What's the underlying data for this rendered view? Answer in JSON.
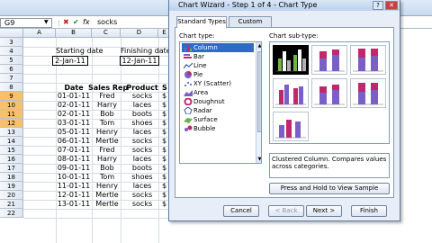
{
  "formula_bar": {
    "name_box": "G9",
    "fx_buttons": [
      "✖",
      "✔",
      "fx"
    ],
    "value": "socks"
  },
  "columns": [
    "A",
    "B",
    "C",
    "D",
    "E"
  ],
  "rows": [
    "3",
    "4",
    "5",
    "6",
    "7",
    "8",
    "9",
    "10",
    "11",
    "12",
    "13",
    "14",
    "15",
    "16",
    "17",
    "18",
    "19",
    "20",
    "21",
    "22"
  ],
  "labels": {
    "starting_date_label": "Starting date",
    "finishing_date_label": "Finishing date",
    "starting_date": "2-Jan-11",
    "finishing_date": "12-Jan-11"
  },
  "table": {
    "headers": [
      "Date",
      "Sales Rep",
      "Product",
      "S"
    ],
    "rows": [
      [
        "01-01-11",
        "Fred",
        "socks",
        "$"
      ],
      [
        "02-01-11",
        "Harry",
        "laces",
        "$"
      ],
      [
        "02-01-11",
        "Bob",
        "boots",
        "$"
      ],
      [
        "03-01-11",
        "Tom",
        "shoes",
        "$"
      ],
      [
        "05-01-11",
        "Henry",
        "laces",
        "$"
      ],
      [
        "06-01-11",
        "Mertle",
        "socks",
        "$"
      ],
      [
        "07-01-11",
        "Fred",
        "socks",
        "$"
      ],
      [
        "08-01-11",
        "Harry",
        "laces",
        "$"
      ],
      [
        "09-01-11",
        "Bob",
        "boots",
        "$"
      ],
      [
        "10-01-11",
        "Tom",
        "shoes",
        "$"
      ],
      [
        "11-01-11",
        "Henry",
        "laces",
        "$"
      ],
      [
        "12-01-11",
        "Mertle",
        "socks",
        "$"
      ],
      [
        "13-01-11",
        "Mertle",
        "socks",
        "$"
      ]
    ]
  },
  "dialog": {
    "title": "Chart Wizard - Step 1 of 4 - Chart Type",
    "help": "?",
    "close": "✕",
    "tabs": [
      "Standard Types",
      "Custom Types"
    ],
    "chart_type_label": "Chart type:",
    "chart_subtype_label": "Chart sub-type:",
    "chart_types": [
      {
        "label": "Column",
        "icon": "column-chart-icon"
      },
      {
        "label": "Bar",
        "icon": "bar-chart-icon"
      },
      {
        "label": "Line",
        "icon": "line-chart-icon"
      },
      {
        "label": "Pie",
        "icon": "pie-chart-icon"
      },
      {
        "label": "XY (Scatter)",
        "icon": "scatter-chart-icon"
      },
      {
        "label": "Area",
        "icon": "area-chart-icon"
      },
      {
        "label": "Doughnut",
        "icon": "doughnut-chart-icon"
      },
      {
        "label": "Radar",
        "icon": "radar-chart-icon"
      },
      {
        "label": "Surface",
        "icon": "surface-chart-icon"
      },
      {
        "label": "Bubble",
        "icon": "bubble-chart-icon"
      }
    ],
    "selected_type": "Column",
    "description": "Clustered Column. Compares values across categories.",
    "preview_button": "Press and Hold to View Sample",
    "buttons": {
      "cancel": "Cancel",
      "back": "< Back",
      "next": "Next >",
      "finish": "Finish"
    }
  },
  "colors": {
    "accent": "#316ac5",
    "bar_purple": "#7b5fc8",
    "bar_pink": "#c0286e",
    "bar_gray": "#b0b0b0",
    "bar_green": "#6fb44a",
    "selection_header": "#f9c06a"
  }
}
